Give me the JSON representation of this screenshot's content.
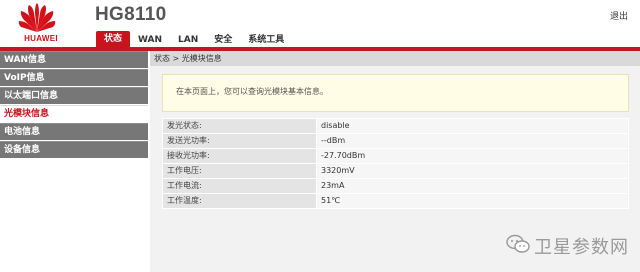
{
  "header": {
    "brand": "HUAWEI",
    "device_model": "HG8110",
    "logout_label": "退出",
    "tabs": [
      {
        "label": "状态",
        "active": true
      },
      {
        "label": "WAN",
        "active": false
      },
      {
        "label": "LAN",
        "active": false
      },
      {
        "label": "安全",
        "active": false
      },
      {
        "label": "系统工具",
        "active": false
      }
    ]
  },
  "sidebar": {
    "items": [
      {
        "label": "WAN信息",
        "active": false
      },
      {
        "label": "VoIP信息",
        "active": false
      },
      {
        "label": "以太端口信息",
        "active": false
      },
      {
        "label": "光模块信息",
        "active": true
      },
      {
        "label": "电池信息",
        "active": false
      },
      {
        "label": "设备信息",
        "active": false
      }
    ]
  },
  "main": {
    "breadcrumb": "状态 > 光模块信息",
    "info_text": "在本页面上，您可以查询光模块基本信息。",
    "rows": [
      {
        "label": "发光状态:",
        "value": "disable"
      },
      {
        "label": "发送光功率:",
        "value": "--dBm"
      },
      {
        "label": "接收光功率:",
        "value": "-27.70dBm"
      },
      {
        "label": "工作电压:",
        "value": "3320mV"
      },
      {
        "label": "工作电流:",
        "value": "23mA"
      },
      {
        "label": "工作温度:",
        "value": "51℃"
      }
    ]
  },
  "watermark": {
    "text": "卫星参数网",
    "icon": "wechat-icon"
  },
  "colors": {
    "brand_red": "#c8141c",
    "sidebar_gray": "#777777",
    "info_bg": "#fffde6"
  }
}
